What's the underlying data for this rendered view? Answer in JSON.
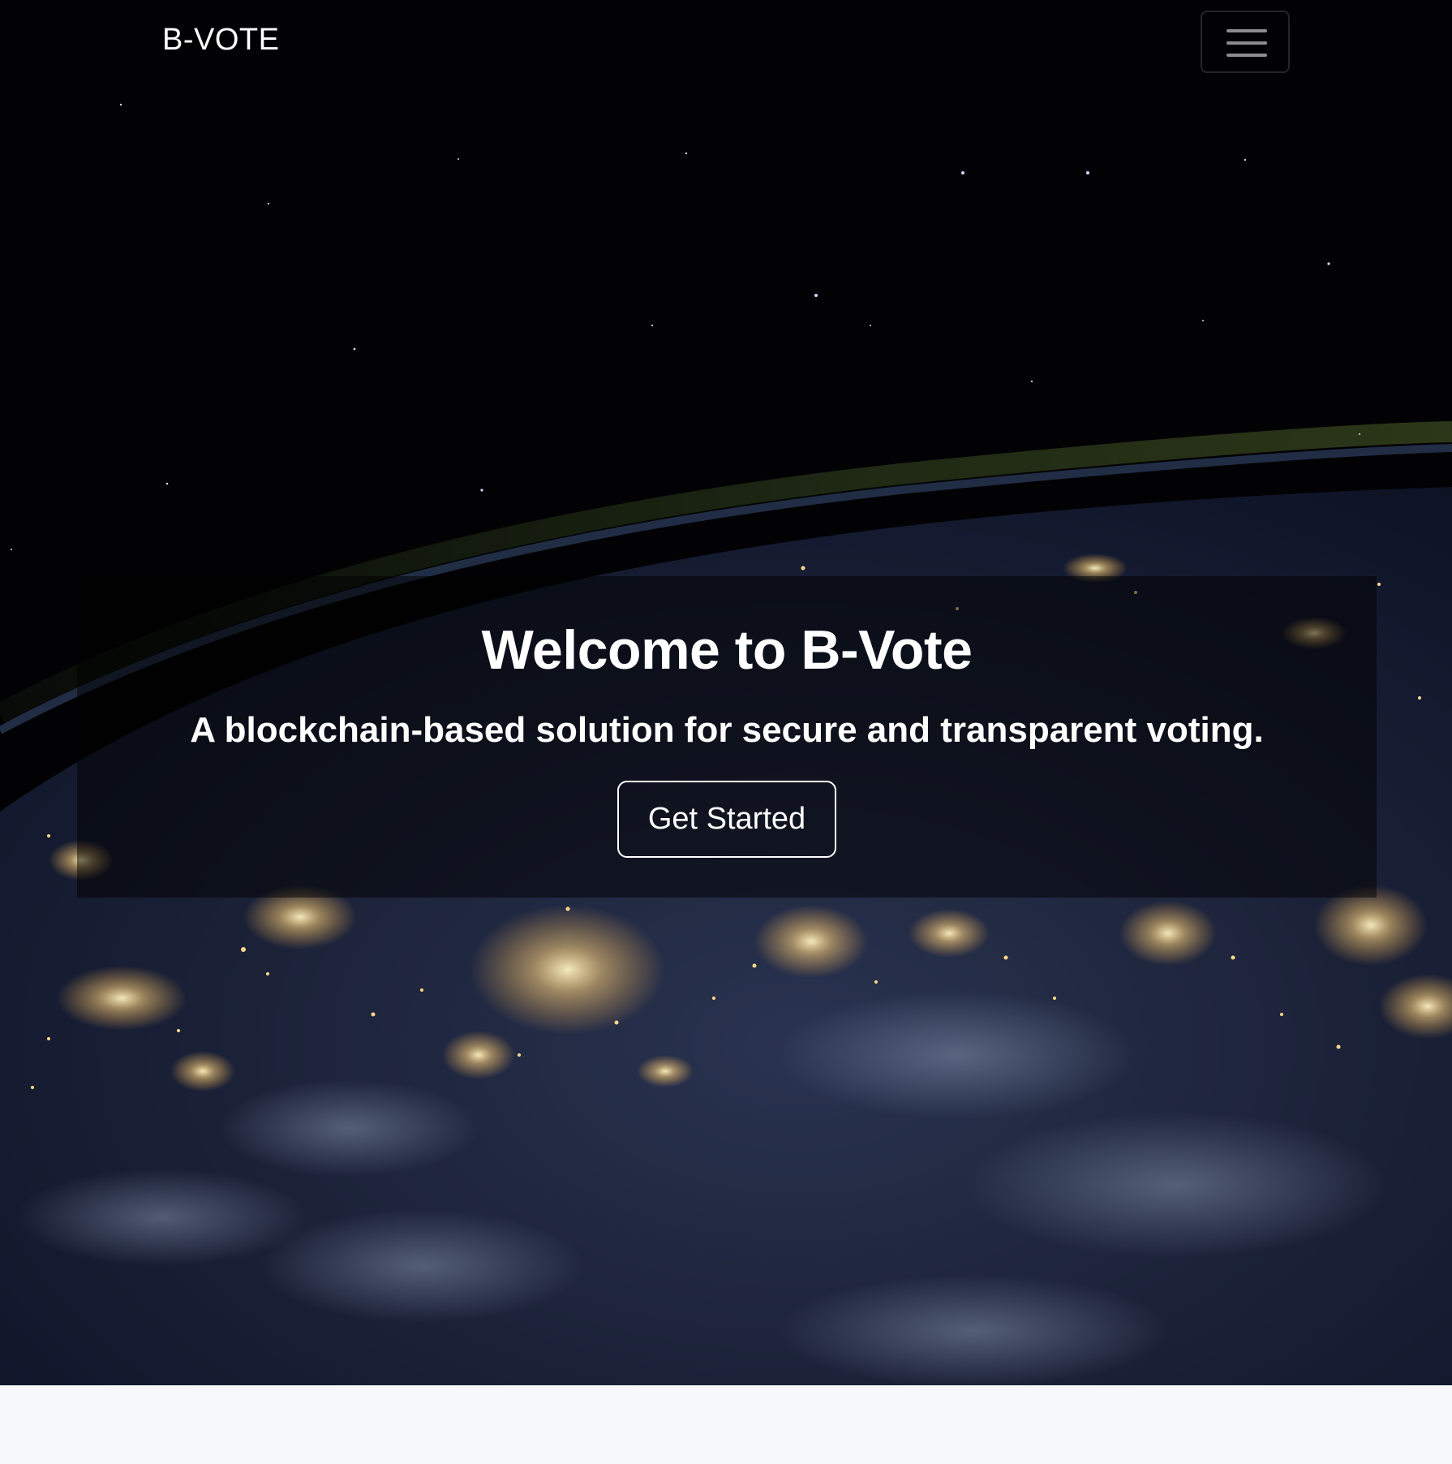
{
  "navbar": {
    "brand": "B-VOTE",
    "menu_icon": "hamburger-menu-icon"
  },
  "hero": {
    "title": "Welcome to B-Vote",
    "subtitle": "A blockchain-based solution for secure and transparent voting.",
    "cta_label": "Get Started",
    "background_image": "earth-at-night-from-space"
  },
  "colors": {
    "background": "#000000",
    "text": "#ffffff",
    "overlay": "rgba(0,0,0,0.5)",
    "bottom_strip": "#f7f8fa",
    "city_lights": "#ffd98a"
  }
}
